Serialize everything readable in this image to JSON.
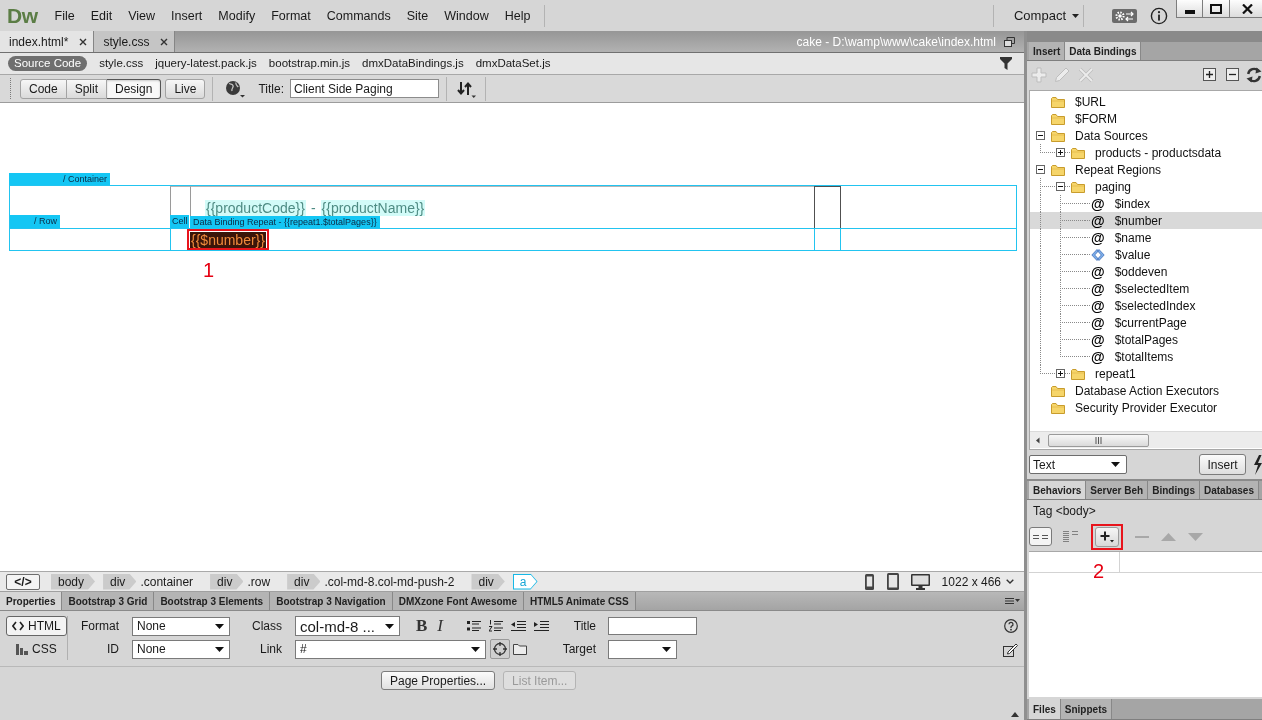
{
  "menubar": {
    "logo": "Dw",
    "menus": [
      "File",
      "Edit",
      "View",
      "Insert",
      "Modify",
      "Format",
      "Commands",
      "Site",
      "Window",
      "Help"
    ],
    "workspace": "Compact"
  },
  "document": {
    "tabs": [
      {
        "label": "index.html*",
        "selected": true
      },
      {
        "label": "style.css",
        "selected": false
      }
    ],
    "path": "cake - D:\\wamp\\www\\cake\\index.html"
  },
  "related_files": [
    {
      "label": "Source Code",
      "selected": true
    },
    {
      "label": "style.css",
      "selected": false
    },
    {
      "label": "jquery-latest.pack.js",
      "selected": false
    },
    {
      "label": "bootstrap.min.js",
      "selected": false
    },
    {
      "label": "dmxDataBindings.js",
      "selected": false
    },
    {
      "label": "dmxDataSet.js",
      "selected": false
    }
  ],
  "toolbar": {
    "view_modes": [
      {
        "label": "Code",
        "selected": false
      },
      {
        "label": "Split",
        "selected": false
      },
      {
        "label": "Design",
        "selected": true
      }
    ],
    "live": {
      "label": "Live",
      "selected": false
    },
    "title_label": "Title:",
    "title_value": "Client Side Paging"
  },
  "canvas": {
    "container_label": "/ Container",
    "row_label": "/ Row",
    "cell_label": "Cell",
    "repeat_label": "Data Binding Repeat - {{repeat1.$totalPages}}",
    "row_content": [
      {
        "kind": "binding",
        "text": "{{productCode}}"
      },
      {
        "kind": "text",
        "text": "-"
      },
      {
        "kind": "binding",
        "text": "{{productName}}"
      }
    ],
    "number_binding": {
      "text": "{{$number}}",
      "selected": true,
      "annotation": "1"
    }
  },
  "tag_selector": {
    "code_button": "</>",
    "crumbs": [
      {
        "tag": "body",
        "selected": false
      },
      {
        "tag": "div",
        "class": ".container",
        "selected": false
      },
      {
        "tag": "div",
        "class": ".row",
        "selected": false
      },
      {
        "tag": "div",
        "class": ".col-md-8.col-md-push-2",
        "selected": false
      },
      {
        "tag": "div",
        "selected": false
      },
      {
        "tag": "a",
        "selected": true
      }
    ],
    "size": "1022 x 466"
  },
  "properties": {
    "tabs": [
      {
        "label": "Properties",
        "selected": true
      },
      {
        "label": "Bootstrap 3 Grid",
        "selected": false
      },
      {
        "label": "Bootstrap 3 Elements",
        "selected": false
      },
      {
        "label": "Bootstrap 3 Navigation",
        "selected": false
      },
      {
        "label": "DMXzone Font Awesome",
        "selected": false
      },
      {
        "label": "HTML5 Animate CSS",
        "selected": false
      }
    ],
    "modes": [
      {
        "label": "HTML",
        "kind": "html",
        "selected": true
      },
      {
        "label": "CSS",
        "kind": "css",
        "selected": false
      }
    ],
    "format": {
      "label": "Format",
      "value": "None"
    },
    "id": {
      "label": "ID",
      "value": "None"
    },
    "class": {
      "label": "Class",
      "value": "col-md-8 ..."
    },
    "bold": "B",
    "italic": "I",
    "link": {
      "label": "Link",
      "value": "#"
    },
    "title": {
      "label": "Title"
    },
    "target": {
      "label": "Target"
    },
    "buttons": [
      {
        "label": "Page Properties...",
        "disabled": false
      },
      {
        "label": "List Item...",
        "disabled": true
      }
    ]
  },
  "data_bindings": {
    "tabs": [
      {
        "label": "Insert",
        "selected": false
      },
      {
        "label": "Data Bindings",
        "selected": true
      }
    ],
    "tools": [
      {
        "kind": "add",
        "disabled": true
      },
      {
        "kind": "edit",
        "disabled": true
      },
      {
        "kind": "delete",
        "disabled": true
      }
    ],
    "tree": [
      {
        "label": "$URL",
        "kind": "folder",
        "selected": false
      },
      {
        "label": "$FORM",
        "kind": "folder",
        "selected": false
      },
      {
        "label": "Data Sources",
        "kind": "folder",
        "selected": false,
        "expanded": true,
        "children": [
          {
            "label": "products - productsdata",
            "kind": "folder",
            "selected": false,
            "expanded": false
          }
        ]
      },
      {
        "label": "Repeat Regions",
        "kind": "folder",
        "selected": false,
        "expanded": true,
        "children": [
          {
            "label": "paging",
            "kind": "folder",
            "selected": false,
            "expanded": true,
            "children": [
              {
                "label": "$index",
                "kind": "field",
                "glyph": "@",
                "selected": false
              },
              {
                "label": "$number",
                "kind": "field",
                "glyph": "@",
                "selected": true
              },
              {
                "label": "$name",
                "kind": "field",
                "glyph": "@",
                "selected": false
              },
              {
                "label": "$value",
                "kind": "element",
                "selected": false
              },
              {
                "label": "$oddeven",
                "kind": "field",
                "glyph": "@",
                "selected": false
              },
              {
                "label": "$selectedItem",
                "kind": "field",
                "glyph": "@",
                "selected": false
              },
              {
                "label": "$selectedIndex",
                "kind": "field",
                "glyph": "@",
                "selected": false
              },
              {
                "label": "$currentPage",
                "kind": "field",
                "glyph": "@",
                "selected": false
              },
              {
                "label": "$totalPages",
                "kind": "field",
                "glyph": "@",
                "selected": false
              },
              {
                "label": "$totalItems",
                "kind": "field",
                "glyph": "@",
                "selected": false
              }
            ]
          },
          {
            "label": "repeat1",
            "kind": "folder",
            "selected": false,
            "expanded": false
          }
        ]
      },
      {
        "label": "Database Action Executors",
        "kind": "folder",
        "selected": false
      },
      {
        "label": "Security Provider Executor",
        "kind": "folder",
        "selected": false
      }
    ],
    "insert_as": "Text",
    "insert_button": "Insert"
  },
  "behaviors": {
    "tabs": [
      {
        "label": "Behaviors",
        "selected": true
      },
      {
        "label": "Server Beh",
        "selected": false
      },
      {
        "label": "Bindings",
        "selected": false
      },
      {
        "label": "Databases",
        "selected": false
      }
    ],
    "tag": "Tag <body>",
    "views": [
      {
        "kind": "set-events",
        "selected": true
      },
      {
        "kind": "all-events",
        "selected": false
      }
    ],
    "actions": [
      {
        "kind": "add",
        "disabled": false,
        "annotation": "2"
      },
      {
        "kind": "remove",
        "disabled": true
      },
      {
        "kind": "up",
        "disabled": true
      },
      {
        "kind": "down",
        "disabled": true
      }
    ]
  },
  "bottom_tabs": [
    {
      "label": "Files",
      "selected": true
    },
    {
      "label": "Snippets",
      "selected": false
    }
  ]
}
